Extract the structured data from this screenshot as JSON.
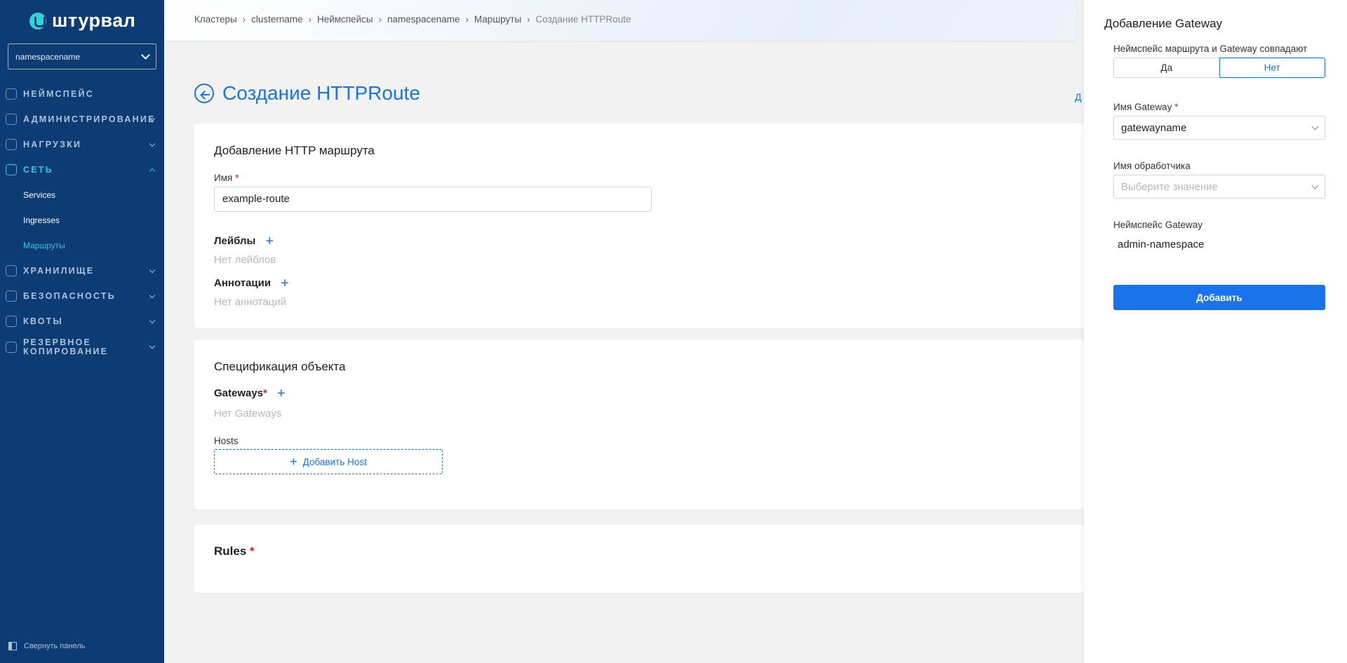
{
  "app": {
    "logo_text": "штурвал"
  },
  "namespace_select": {
    "value": "namespacename"
  },
  "sidebar": {
    "items": [
      {
        "label": "НЕЙМСПЕЙС",
        "icon": "namespace-icon"
      },
      {
        "label": "АДМИНИСТРИРОВАНИЕ",
        "icon": "admin-gear-icon"
      },
      {
        "label": "НАГРУЗКИ",
        "icon": "workloads-icon"
      },
      {
        "label": "СЕТЬ",
        "icon": "network-icon",
        "sub": [
          "Services",
          "Ingresses",
          "Маршруты"
        ]
      },
      {
        "label": "ХРАНИЛИЩЕ",
        "icon": "storage-icon"
      },
      {
        "label": "БЕЗОПАСНОСТЬ",
        "icon": "security-shield-icon"
      },
      {
        "label": "КВОТЫ",
        "icon": "quotas-icon"
      },
      {
        "label": "РЕЗЕРВНОЕ КОПИРОВАНИЕ",
        "label_line1": "РЕЗЕРВНОЕ",
        "label_line2": "КОПИРОВАНИЕ",
        "icon": "backup-icon"
      }
    ],
    "collapse_label": "Свернуть панель"
  },
  "breadcrumb": [
    "Кластеры",
    "clustername",
    "Неймспейсы",
    "namespacename",
    "Маршруты",
    "Создание HTTPRoute"
  ],
  "page": {
    "title": "Создание HTTPRoute",
    "side_link_fragment": "Д"
  },
  "card_http": {
    "title": "Добавление HTTP маршрута",
    "name_label": "Имя",
    "name_value": "example-route",
    "labels_title": "Лейблы",
    "labels_empty": "Нет лейблов",
    "annotations_title": "Аннотации",
    "annotations_empty": "Нет аннотаций"
  },
  "card_spec": {
    "title": "Спецификация объекта",
    "gateways_title": "Gateways",
    "gateways_empty": "Нет Gateways",
    "hosts_label": "Hosts",
    "add_host_label": "Добавить Host"
  },
  "card_rules": {
    "title": "Rules"
  },
  "panel": {
    "title": "Добавление Gateway",
    "same_ns_label": "Неймспейс маршрута и Gateway совпадают",
    "opt_yes": "Да",
    "opt_no": "Нет",
    "selected_option": "Нет",
    "gateway_name_label": "Имя Gateway",
    "gateway_name_value": "gatewayname",
    "listener_label": "Имя обработчика",
    "listener_placeholder": "Выберите значение",
    "gateway_ns_label": "Неймспейс Gateway",
    "gateway_ns_value": "admin-namespace",
    "add_button": "Добавить"
  },
  "colors": {
    "sidebar_bg": "#0d3b73",
    "accent": "#1a73e8",
    "active_nav": "#2ec9d3",
    "required": "#e02424"
  }
}
